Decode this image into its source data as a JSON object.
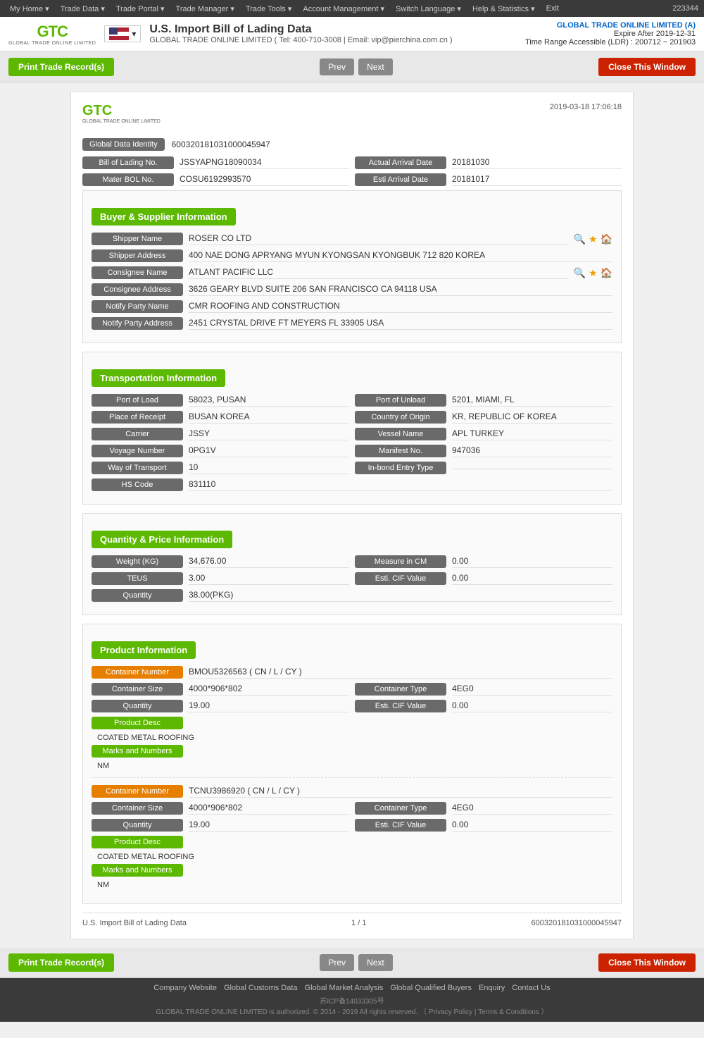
{
  "topnav": {
    "items": [
      "My Home",
      "Trade Data",
      "Trade Portal",
      "Trade Manager",
      "Trade Tools",
      "Account Management",
      "Switch Language",
      "Help & Statistics",
      "Exit"
    ],
    "user_id": "223344"
  },
  "header": {
    "logo": "GTC",
    "logo_sub": "GLOBAL TRADE ONLINE LIMITED",
    "flag_alt": "US Flag",
    "title": "U.S. Import Bill of Lading Data",
    "subtitle": "GLOBAL TRADE ONLINE LIMITED ( Tel: 400-710-3008 | Email: vip@pierchina.com.cn )",
    "company_name": "GLOBAL TRADE ONLINE LIMITED (A)",
    "expire": "Expire After 2019-12-31",
    "time_range": "Time Range Accessible (LDR) : 200712 ~ 201903"
  },
  "toolbar": {
    "print_label": "Print Trade Record(s)",
    "prev_label": "Prev",
    "next_label": "Next",
    "close_label": "Close This Window"
  },
  "document": {
    "logo": "GTC",
    "logo_sub": "GLOBAL TRADE ONLINE LIMITED",
    "date": "2019-03-18 17:06:18",
    "global_data_identity_label": "Global Data Identity",
    "global_data_identity_value": "600320181031000045947",
    "bol_no_label": "Bill of Lading No.",
    "bol_no_value": "JSSYAPNG18090034",
    "actual_arrival_date_label": "Actual Arrival Date",
    "actual_arrival_date_value": "20181030",
    "mater_bol_label": "Mater BOL No.",
    "mater_bol_value": "COSU6192993570",
    "esti_arrival_label": "Esti Arrival Date",
    "esti_arrival_value": "20181017",
    "buyer_supplier_title": "Buyer & Supplier Information",
    "shipper_name_label": "Shipper Name",
    "shipper_name_value": "ROSER CO LTD",
    "shipper_address_label": "Shipper Address",
    "shipper_address_value": "400 NAE DONG APRYANG MYUN KYONGSAN KYONGBUK 712 820 KOREA",
    "consignee_name_label": "Consignee Name",
    "consignee_name_value": "ATLANT PACIFIC LLC",
    "consignee_address_label": "Consignee Address",
    "consignee_address_value": "3626 GEARY BLVD SUITE 206 SAN FRANCISCO CA 94118 USA",
    "notify_party_name_label": "Notify Party Name",
    "notify_party_name_value": "CMR ROOFING AND CONSTRUCTION",
    "notify_party_address_label": "Notify Party Address",
    "notify_party_address_value": "2451 CRYSTAL DRIVE FT MEYERS FL 33905 USA",
    "transport_title": "Transportation Information",
    "port_of_load_label": "Port of Load",
    "port_of_load_value": "58023, PUSAN",
    "port_of_unload_label": "Port of Unload",
    "port_of_unload_value": "5201, MIAMI, FL",
    "place_of_receipt_label": "Place of Receipt",
    "place_of_receipt_value": "BUSAN KOREA",
    "country_of_origin_label": "Country of Origin",
    "country_of_origin_value": "KR, REPUBLIC OF KOREA",
    "carrier_label": "Carrier",
    "carrier_value": "JSSY",
    "vessel_name_label": "Vessel Name",
    "vessel_name_value": "APL TURKEY",
    "voyage_number_label": "Voyage Number",
    "voyage_number_value": "0PG1V",
    "manifest_no_label": "Manifest No.",
    "manifest_no_value": "947036",
    "way_of_transport_label": "Way of Transport",
    "way_of_transport_value": "10",
    "inbond_entry_label": "In-bond Entry Type",
    "inbond_entry_value": "",
    "hs_code_label": "HS Code",
    "hs_code_value": "831110",
    "quantity_price_title": "Quantity & Price Information",
    "weight_kg_label": "Weight (KG)",
    "weight_kg_value": "34,676.00",
    "measure_cm_label": "Measure in CM",
    "measure_cm_value": "0.00",
    "teus_label": "TEUS",
    "teus_value": "3.00",
    "esti_cif_label": "Esti. CIF Value",
    "esti_cif_value": "0.00",
    "quantity_label": "Quantity",
    "quantity_value": "38.00(PKG)",
    "product_info_title": "Product Information",
    "containers": [
      {
        "container_number_label": "Container Number",
        "container_number_value": "BMOU5326563 ( CN / L / CY )",
        "container_size_label": "Container Size",
        "container_size_value": "4000*906*802",
        "container_type_label": "Container Type",
        "container_type_value": "4EG0",
        "quantity_label": "Quantity",
        "quantity_value": "19.00",
        "esti_cif_label": "Esti. CIF Value",
        "esti_cif_value": "0.00",
        "product_desc_label": "Product Desc",
        "product_desc_value": "COATED METAL ROOFING",
        "marks_label": "Marks and Numbers",
        "marks_value": "NM"
      },
      {
        "container_number_label": "Container Number",
        "container_number_value": "TCNU3986920 ( CN / L / CY )",
        "container_size_label": "Container Size",
        "container_size_value": "4000*906*802",
        "container_type_label": "Container Type",
        "container_type_value": "4EG0",
        "quantity_label": "Quantity",
        "quantity_value": "19.00",
        "esti_cif_label": "Esti. CIF Value",
        "esti_cif_value": "0.00",
        "product_desc_label": "Product Desc",
        "product_desc_value": "COATED METAL ROOFING",
        "marks_label": "Marks and Numbers",
        "marks_value": "NM"
      }
    ],
    "footer_left": "U.S. Import Bill of Lading Data",
    "footer_center": "1 / 1",
    "footer_right": "600320181031000045947"
  },
  "site_footer": {
    "links": [
      "Company Website",
      "Global Customs Data",
      "Global Market Analysis",
      "Global Qualified Buyers",
      "Enquiry",
      "Contact Us"
    ],
    "icp": "苏ICP备14033305号",
    "copyright": "GLOBAL TRADE ONLINE LIMITED is authorized. © 2014 - 2019 All rights reserved. （ Privacy Policy | Terms & Conditions ）"
  }
}
